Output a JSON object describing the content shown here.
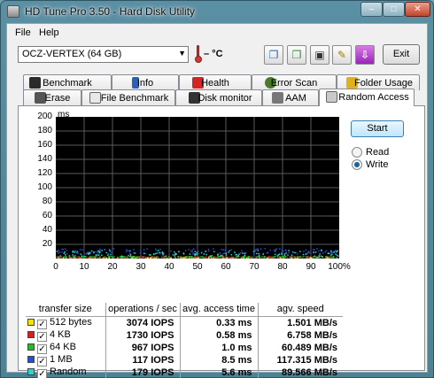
{
  "window": {
    "title": "HD Tune Pro 3.50 - Hard Disk Utility"
  },
  "menu": {
    "file": "File",
    "help": "Help"
  },
  "toolbar": {
    "drive": "OCZ-VERTEX (64 GB)",
    "temperature": "– °C",
    "exit_label": "Exit",
    "icons": [
      "copy-info-icon",
      "copy-screen-icon",
      "save-icon",
      "options-icon",
      "download-icon"
    ]
  },
  "tabs_row1": [
    {
      "label": "Benchmark",
      "icon": "benchmark-icon"
    },
    {
      "label": "Info",
      "icon": "info-icon"
    },
    {
      "label": "Health",
      "icon": "health-icon"
    },
    {
      "label": "Error Scan",
      "icon": "error-scan-icon"
    },
    {
      "label": "Folder Usage",
      "icon": "folder-usage-icon"
    }
  ],
  "tabs_row2": [
    {
      "label": "Erase",
      "icon": "erase-icon"
    },
    {
      "label": "File Benchmark",
      "icon": "file-benchmark-icon"
    },
    {
      "label": "Disk monitor",
      "icon": "disk-monitor-icon"
    },
    {
      "label": "AAM",
      "icon": "aam-icon"
    },
    {
      "label": "Random Access",
      "icon": "random-access-icon",
      "active": true
    }
  ],
  "controls": {
    "start_label": "Start",
    "read_label": "Read",
    "write_label": "Write",
    "selected": "Write"
  },
  "chart_data": {
    "type": "scatter",
    "ylabel": "ms",
    "ylim": [
      0,
      200
    ],
    "xlim": [
      0,
      100
    ],
    "y_ticks": [
      "200",
      "180",
      "160",
      "140",
      "120",
      "100",
      "80",
      "60",
      "40",
      "20"
    ],
    "x_ticks": [
      "0",
      "10",
      "20",
      "30",
      "40",
      "50",
      "60",
      "70",
      "80",
      "90",
      "100%"
    ],
    "grid": true,
    "series": [
      {
        "name": "512 bytes",
        "color": "#f2e600",
        "typical_ms": 0.33
      },
      {
        "name": "4 KB",
        "color": "#d02020",
        "typical_ms": 0.58
      },
      {
        "name": "64 KB",
        "color": "#20c020",
        "typical_ms": 1.0
      },
      {
        "name": "1 MB",
        "color": "#2050e0",
        "typical_ms": 8.5
      },
      {
        "name": "Random",
        "color": "#20d8d8",
        "typical_ms": 5.6
      }
    ]
  },
  "results": {
    "headers": [
      "transfer size",
      "operations / sec",
      "avg. access time",
      "agv. speed"
    ],
    "rows": [
      {
        "size": "512 bytes",
        "ops": "3074 IOPS",
        "access": "0.33 ms",
        "speed": "1.501 MB/s",
        "color": "#f2e600"
      },
      {
        "size": "4 KB",
        "ops": "1730 IOPS",
        "access": "0.58 ms",
        "speed": "6.758 MB/s",
        "color": "#d02020"
      },
      {
        "size": "64 KB",
        "ops": "967 IOPS",
        "access": "1.0 ms",
        "speed": "60.489 MB/s",
        "color": "#20c020"
      },
      {
        "size": "1 MB",
        "ops": "117 IOPS",
        "access": "8.5 ms",
        "speed": "117.315 MB/s",
        "color": "#2050e0"
      },
      {
        "size": "Random",
        "ops": "179 IOPS",
        "access": "5.6 ms",
        "speed": "89.566 MB/s",
        "color": "#20d8d8"
      }
    ]
  }
}
